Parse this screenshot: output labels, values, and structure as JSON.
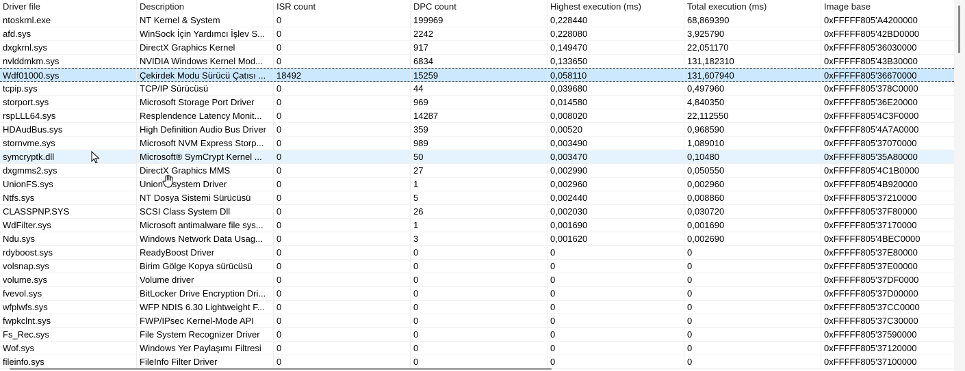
{
  "columns": [
    "Driver file",
    "Description",
    "ISR count",
    "DPC count",
    "Highest execution (ms)",
    "Total execution (ms)",
    "Image base"
  ],
  "rows": [
    [
      "ntoskrnl.exe",
      "NT Kernel & System",
      "0",
      "199969",
      "0,228440",
      "68,869390",
      "0xFFFFF805'A4200000"
    ],
    [
      "afd.sys",
      "WinSock İçin Yardımcı İşlev S...",
      "0",
      "2242",
      "0,228080",
      "3,925790",
      "0xFFFFF805'42BD0000"
    ],
    [
      "dxgkrnl.sys",
      "DirectX Graphics Kernel",
      "0",
      "917",
      "0,149470",
      "22,051170",
      "0xFFFFF805'36030000"
    ],
    [
      "nvlddmkm.sys",
      "NVIDIA Windows Kernel Mod...",
      "0",
      "6834",
      "0,133650",
      "131,182310",
      "0xFFFFF805'43B30000"
    ],
    [
      "Wdf01000.sys",
      "Çekirdek Modu Sürücü Çatısı ...",
      "18492",
      "15259",
      "0,058110",
      "131,607940",
      "0xFFFFF805'36670000"
    ],
    [
      "tcpip.sys",
      "TCP/IP Sürücüsü",
      "0",
      "44",
      "0,039680",
      "0,497960",
      "0xFFFFF805'378C0000"
    ],
    [
      "storport.sys",
      "Microsoft Storage Port Driver",
      "0",
      "969",
      "0,014580",
      "4,840350",
      "0xFFFFF805'36E20000"
    ],
    [
      "rspLLL64.sys",
      "Resplendence Latency Monit...",
      "0",
      "14287",
      "0,008020",
      "22,112550",
      "0xFFFFF805'4C3F0000"
    ],
    [
      "HDAudBus.sys",
      "High Definition Audio Bus Driver",
      "0",
      "359",
      "0,00520",
      "0,968590",
      "0xFFFFF805'4A7A0000"
    ],
    [
      "stornvme.sys",
      "Microsoft NVM Express Storp...",
      "0",
      "989",
      "0,003490",
      "1,089010",
      "0xFFFFF805'37070000"
    ],
    [
      "symcryptk.dll",
      "Microsoft® SymCrypt Kernel ...",
      "0",
      "50",
      "0,003470",
      "0,10480",
      "0xFFFFF805'35A80000"
    ],
    [
      "dxgmms2.sys",
      "DirectX Graphics MMS",
      "0",
      "27",
      "0,002990",
      "0,050550",
      "0xFFFFF805'4C1B0000"
    ],
    [
      "UnionFS.sys",
      "Union  lesystem Driver",
      "0",
      "1",
      "0,002960",
      "0,002960",
      "0xFFFFF805'4B920000"
    ],
    [
      "Ntfs.sys",
      "NT Dosya Sistemi Sürücüsü",
      "0",
      "5",
      "0,002440",
      "0,008860",
      "0xFFFFF805'37210000"
    ],
    [
      "CLASSPNP.SYS",
      "SCSI Class System Dll",
      "0",
      "26",
      "0,002030",
      "0,030720",
      "0xFFFFF805'37F80000"
    ],
    [
      "WdFilter.sys",
      "Microsoft antimalware file sys...",
      "0",
      "1",
      "0,001690",
      "0,001690",
      "0xFFFFF805'37170000"
    ],
    [
      "Ndu.sys",
      "Windows Network Data Usag...",
      "0",
      "3",
      "0,001620",
      "0,002690",
      "0xFFFFF805'4BEC0000"
    ],
    [
      "rdyboost.sys",
      "ReadyBoost Driver",
      "0",
      "0",
      "0",
      "0",
      "0xFFFFF805'37E80000"
    ],
    [
      "volsnap.sys",
      "Birim Gölge Kopya sürücüsü",
      "0",
      "0",
      "0",
      "0",
      "0xFFFFF805'37E00000"
    ],
    [
      "volume.sys",
      "Volume driver",
      "0",
      "0",
      "0",
      "0",
      "0xFFFFF805'37DF0000"
    ],
    [
      "fvevol.sys",
      "BitLocker Drive Encryption Dri...",
      "0",
      "0",
      "0",
      "0",
      "0xFFFFF805'37D00000"
    ],
    [
      "wfplwfs.sys",
      "WFP NDIS 6.30 Lightweight F...",
      "0",
      "0",
      "0",
      "0",
      "0xFFFFF805'37CC0000"
    ],
    [
      "fwpkclnt.sys",
      "FWP/IPsec Kernel-Mode API",
      "0",
      "0",
      "0",
      "0",
      "0xFFFFF805'37C30000"
    ],
    [
      "Fs_Rec.sys",
      "File System Recognizer Driver",
      "0",
      "0",
      "0",
      "0",
      "0xFFFFF805'37590000"
    ],
    [
      "Wof.sys",
      "Windows Yer Paylaşımı Filtresi",
      "0",
      "0",
      "0",
      "0",
      "0xFFFFF805'37120000"
    ],
    [
      "fileinfo.sys",
      "FileInfo Filter Driver",
      "0",
      "0",
      "0",
      "0",
      "0xFFFFF805'37100000"
    ]
  ],
  "selected_row": 4,
  "hover_row": 10,
  "colors": {
    "selection": "#cce8ff",
    "hover": "#e5f3ff"
  },
  "icons": [
    "arrow-cursor-icon",
    "hand-cursor-icon"
  ]
}
